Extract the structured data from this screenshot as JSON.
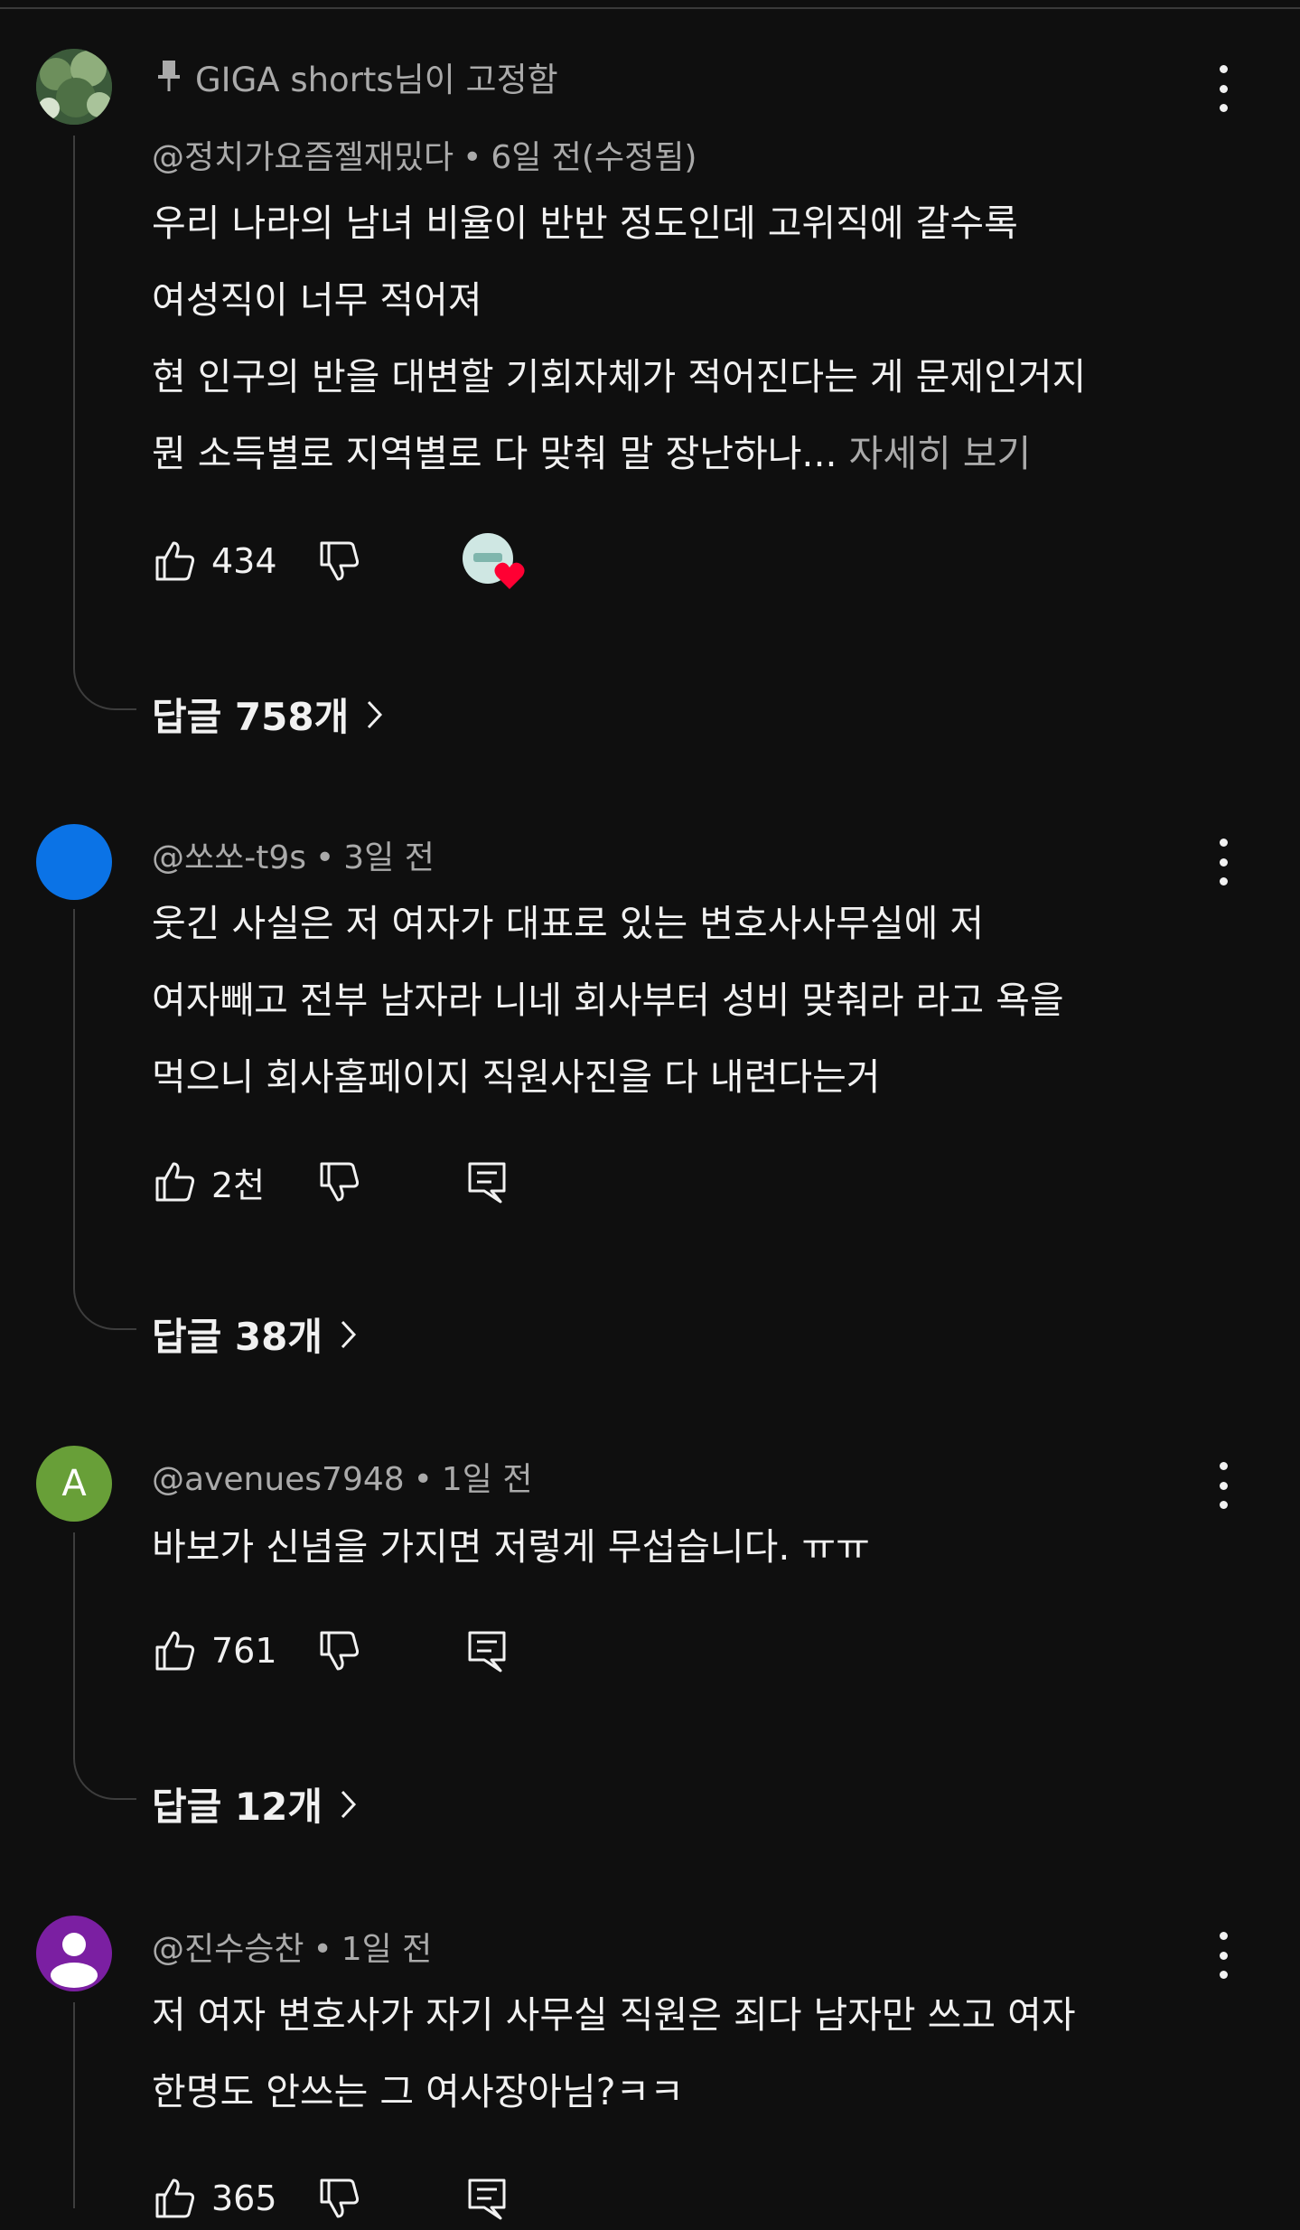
{
  "comments": [
    {
      "pinned_label": "GIGA shorts님이 고정함",
      "author": "@정치가요즘젤재밌다",
      "time": "6일 전(수정됨)",
      "lines": [
        "우리 나라의 남녀 비율이 반반 정도인데 고위직에 갈수록",
        "여성직이 너무 적어져",
        "현 인구의 반을 대변할 기회자체가 적어진다는 게 문제인거지",
        "뭔 소득별로 지역별로 다 맞춰 말 장난하나..."
      ],
      "more_label": "자세히 보기",
      "likes": "434",
      "replies_label": "답글 758개",
      "avatar": {
        "type": "photo",
        "color": "#2f4a30"
      }
    },
    {
      "author": "@쏘쏘-t9s",
      "time": "3일 전",
      "lines": [
        "웃긴 사실은 저 여자가 대표로 있는 변호사사무실에 저",
        "여자빼고 전부 남자라 니네 회사부터 성비 맞춰라 라고 욕을",
        "먹으니 회사홈페이지 직원사진을 다 내련다는거"
      ],
      "likes": "2천",
      "replies_label": "답글 38개",
      "avatar": {
        "type": "solid",
        "color": "#0b73e6"
      }
    },
    {
      "author": "@avenues7948",
      "time": "1일 전",
      "lines": [
        "바보가 신념을 가지면 저렇게 무섭습니다. ㅠㅠ"
      ],
      "likes": "761",
      "replies_label": "답글 12개",
      "avatar": {
        "type": "letter",
        "letter": "A",
        "color": "#689f38"
      }
    },
    {
      "author": "@진수승찬",
      "time": "1일 전",
      "lines": [
        "저 여자 변호사가 자기 사무실 직원은 죄다 남자만 쓰고 여자",
        "한명도 안쓰는 그 여사장아님?ㅋㅋ"
      ],
      "likes": "365",
      "avatar": {
        "type": "person",
        "color": "#7b1fa2"
      }
    }
  ],
  "icons": {
    "like": "thumb-up-icon",
    "dislike": "thumb-down-icon",
    "reply": "reply-icon",
    "pin": "pin-icon",
    "more": "more-vert-icon",
    "heart": "heart-icon",
    "chevron": "chevron-right-icon"
  },
  "colors": {
    "background": "#0f0f0f",
    "text": "#f1f1f1",
    "secondary_text": "#aaaaaa",
    "heart": "#ff0033"
  }
}
